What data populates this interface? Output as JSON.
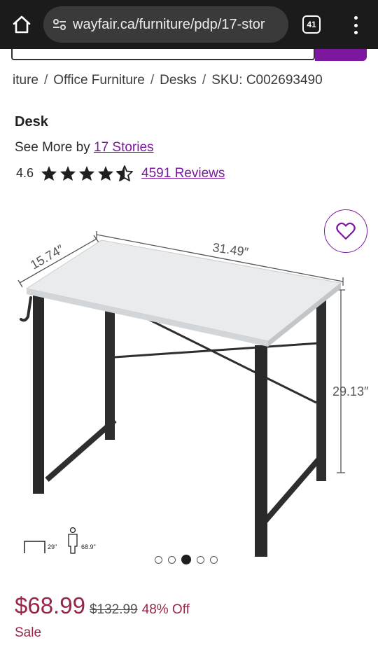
{
  "browser": {
    "url": "wayfair.ca/furniture/pdp/17-stor",
    "tab_count": "41"
  },
  "breadcrumb": {
    "items": [
      "iture",
      "Office Furniture",
      "Desks",
      "SKU: C002693490"
    ],
    "separator": "/"
  },
  "product": {
    "title": "Desk",
    "see_more_prefix": "See More by ",
    "brand": "17 Stories",
    "rating": "4.6",
    "rating_value": 4.6,
    "stars_max": 5,
    "reviews": "4591 Reviews"
  },
  "image": {
    "dim_depth": "15.74″",
    "dim_width": "31.49″",
    "dim_height": "29.13″",
    "scale_desk_height": "29\"",
    "scale_person_height": "68.9\"",
    "carousel_total": 5,
    "carousel_active": 3
  },
  "pricing": {
    "price": "$68.99",
    "old_price": "$132.99",
    "discount": "48% Off",
    "sale_label": "Sale"
  },
  "colors": {
    "brand_purple": "#7b189f",
    "sale_red": "#9a2446",
    "browser_bar": "#1b1b1b"
  }
}
